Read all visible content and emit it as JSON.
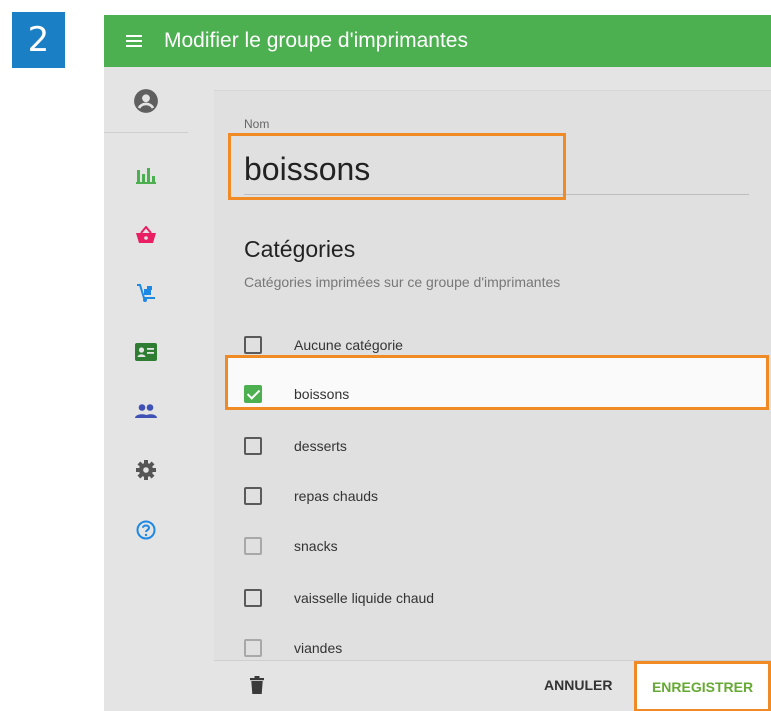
{
  "step": {
    "number": "2"
  },
  "header": {
    "title": "Modifier le groupe d'imprimantes"
  },
  "sidebar": {
    "items": [
      {
        "icon": "account-circle-icon"
      },
      {
        "icon": "bar-chart-icon",
        "color": "#4caf50"
      },
      {
        "icon": "basket-icon",
        "color": "#e91e63"
      },
      {
        "icon": "hand-truck-icon",
        "color": "#1e88e5"
      },
      {
        "icon": "id-card-icon",
        "color": "#2e7d32"
      },
      {
        "icon": "people-icon",
        "color": "#3f51b5"
      },
      {
        "icon": "gear-icon",
        "color": "#555555"
      },
      {
        "icon": "help-circle-icon",
        "color": "#1e88e5"
      }
    ]
  },
  "form": {
    "name_label": "Nom",
    "name_value": "boissons",
    "categories_title": "Catégories",
    "categories_subtitle": "Catégories imprimées sur ce groupe d'imprimantes",
    "categories": [
      {
        "label": "Aucune catégorie",
        "checked": false,
        "dim": false
      },
      {
        "label": "boissons",
        "checked": true,
        "dim": false
      },
      {
        "label": "desserts",
        "checked": false,
        "dim": false
      },
      {
        "label": "repas chauds",
        "checked": false,
        "dim": false
      },
      {
        "label": "snacks",
        "checked": false,
        "dim": true
      },
      {
        "label": "vaisselle liquide chaud",
        "checked": false,
        "dim": false
      },
      {
        "label": "viandes",
        "checked": false,
        "dim": true
      }
    ]
  },
  "footer": {
    "cancel_label": "ANNULER",
    "save_label": "ENREGISTRER"
  },
  "colors": {
    "primary": "#4caf50",
    "highlight": "#f08a24",
    "save_text": "#66aa33"
  }
}
